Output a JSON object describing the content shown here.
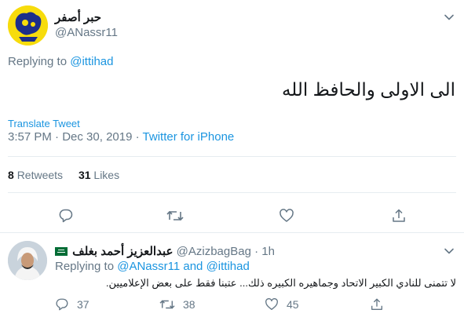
{
  "tweet": {
    "author_name": "حبر أصفر",
    "author_handle": "@ANassr11",
    "replying_prefix": "Replying to",
    "replying_handle": "@ittihad",
    "text": "الى الاولى والحافظ الله",
    "translate_label": "Translate Tweet",
    "time": "3:57 PM",
    "date_sep": "·",
    "date": "Dec 30, 2019",
    "source_sep": "·",
    "source": "Twitter for iPhone",
    "retweets_count": "8",
    "retweets_label": "Retweets",
    "likes_count": "31",
    "likes_label": "Likes"
  },
  "reply": {
    "author_name": "عبدالعزيز أحمد بغلف",
    "flag": "saudi-flag",
    "author_handle": "@AzizbagBag",
    "time_sep": "·",
    "time": "1h",
    "replying_prefix": "Replying to",
    "replying_handle1": "@ANassr11",
    "replying_and": "and",
    "replying_handle2": "@ittihad",
    "text": "لا تتمنى للنادي الكبير الاتحاد وجماهيره الكبيره ذلك... عتبنا فقط على بعض الإعلاميين.",
    "reply_count": "37",
    "retweet_count": "38",
    "like_count": "45"
  },
  "icons": {
    "reply": "reply-icon",
    "retweet": "retweet-icon",
    "like": "heart-icon",
    "share": "share-icon",
    "more": "chevron-down-icon"
  },
  "colors": {
    "link": "#1b95e0",
    "muted": "#657786",
    "divider": "#e6ecf0",
    "flag": "#006c35"
  }
}
